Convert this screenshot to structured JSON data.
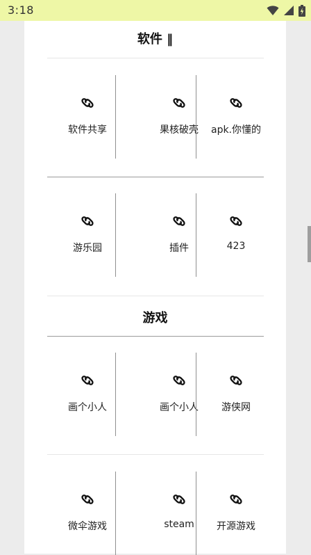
{
  "status_bar": {
    "time": "3:18"
  },
  "sections": [
    {
      "title": "软件 ‖",
      "rows": [
        [
          "软件共享",
          "果核破壳",
          "apk.你懂的"
        ],
        [
          "游乐园",
          "插件",
          "423"
        ]
      ]
    },
    {
      "title": "游戏",
      "rows": [
        [
          "画个小人",
          "画个小人",
          "游侠网"
        ],
        [
          "微伞游戏",
          "steam",
          "开源游戏"
        ]
      ]
    }
  ],
  "colors": {
    "status_bar_bg": "#eef7a6",
    "card_bg": "#ffffff",
    "page_bg": "#ececec"
  },
  "icons": {
    "link_item": "link-icon",
    "wifi": "wifi-icon",
    "signal": "signal-icon",
    "battery": "battery-icon"
  }
}
